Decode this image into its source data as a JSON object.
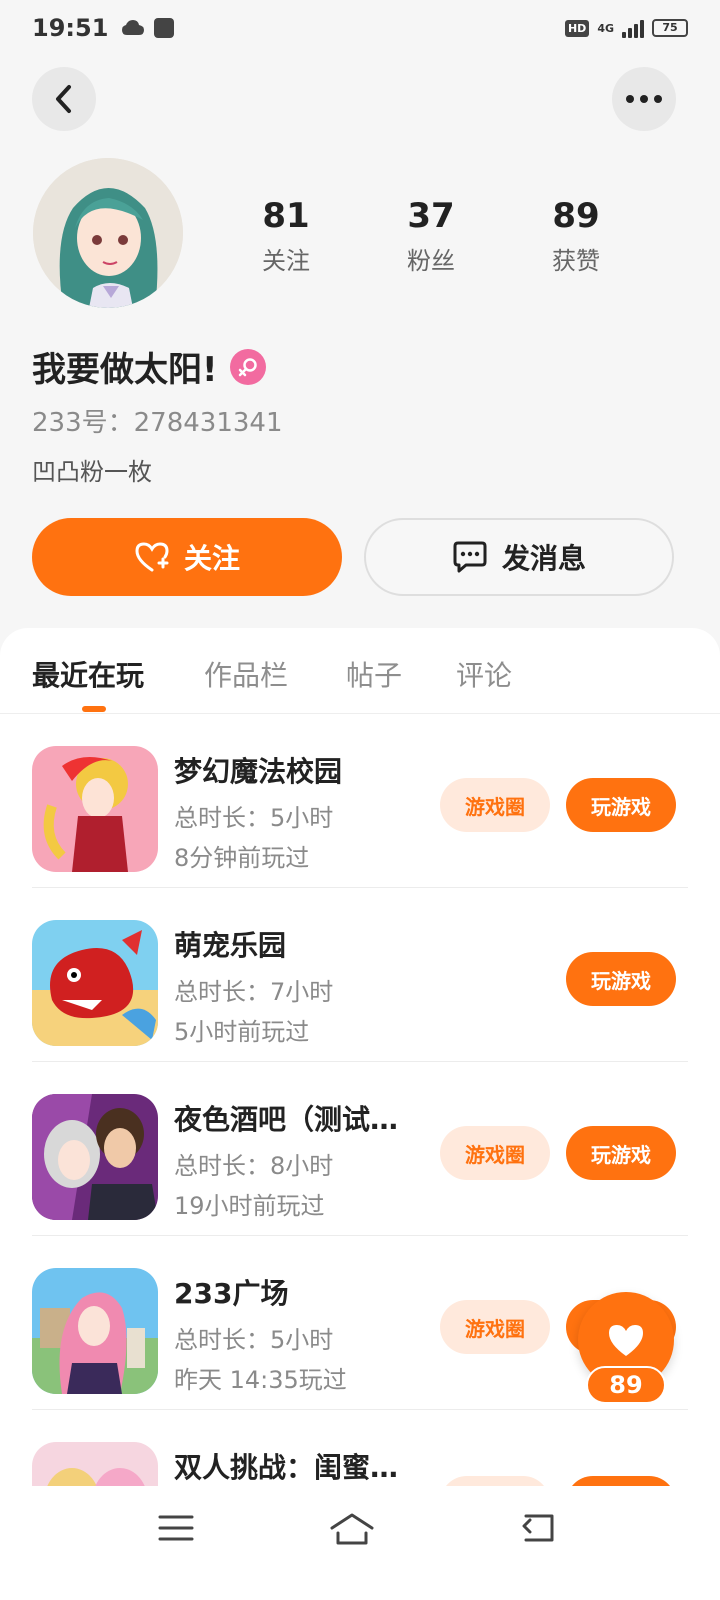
{
  "status_bar": {
    "time": "19:51",
    "battery": "75",
    "network": "4G",
    "hd": "HD"
  },
  "profile": {
    "stats": [
      {
        "value": "81",
        "label": "关注"
      },
      {
        "value": "37",
        "label": "粉丝"
      },
      {
        "value": "89",
        "label": "获赞"
      }
    ],
    "nickname": "我要做太阳!",
    "user_id": "233号：278431341",
    "bio": "凹凸粉一枚"
  },
  "actions": {
    "follow_label": "关注",
    "message_label": "发消息"
  },
  "tabs": [
    {
      "label": "最近在玩"
    },
    {
      "label": "作品栏"
    },
    {
      "label": "帖子"
    },
    {
      "label": "评论"
    }
  ],
  "games": [
    {
      "name": "梦幻魔法校园",
      "duration": "总时长：5小时",
      "last_played": "8分钟前玩过",
      "circle_label": "游戏圈",
      "play_label": "玩游戏"
    },
    {
      "name": "萌宠乐园",
      "duration": "总时长：7小时",
      "last_played": "5小时前玩过",
      "play_label": "玩游戏"
    },
    {
      "name": "夜色酒吧（测试…",
      "duration": "总时长：8小时",
      "last_played": "19小时前玩过",
      "circle_label": "游戏圈",
      "play_label": "玩游戏"
    },
    {
      "name": "233广场",
      "duration": "总时长：5小时",
      "last_played": "昨天  14:35玩过",
      "circle_label": "游戏圈"
    },
    {
      "name": "双人挑战：闺蜜…"
    }
  ],
  "like_float": {
    "count": "89"
  },
  "colors": {
    "accent": "#ff7210",
    "accent_light": "#ffe9dc",
    "gender": "#f26ba0"
  }
}
